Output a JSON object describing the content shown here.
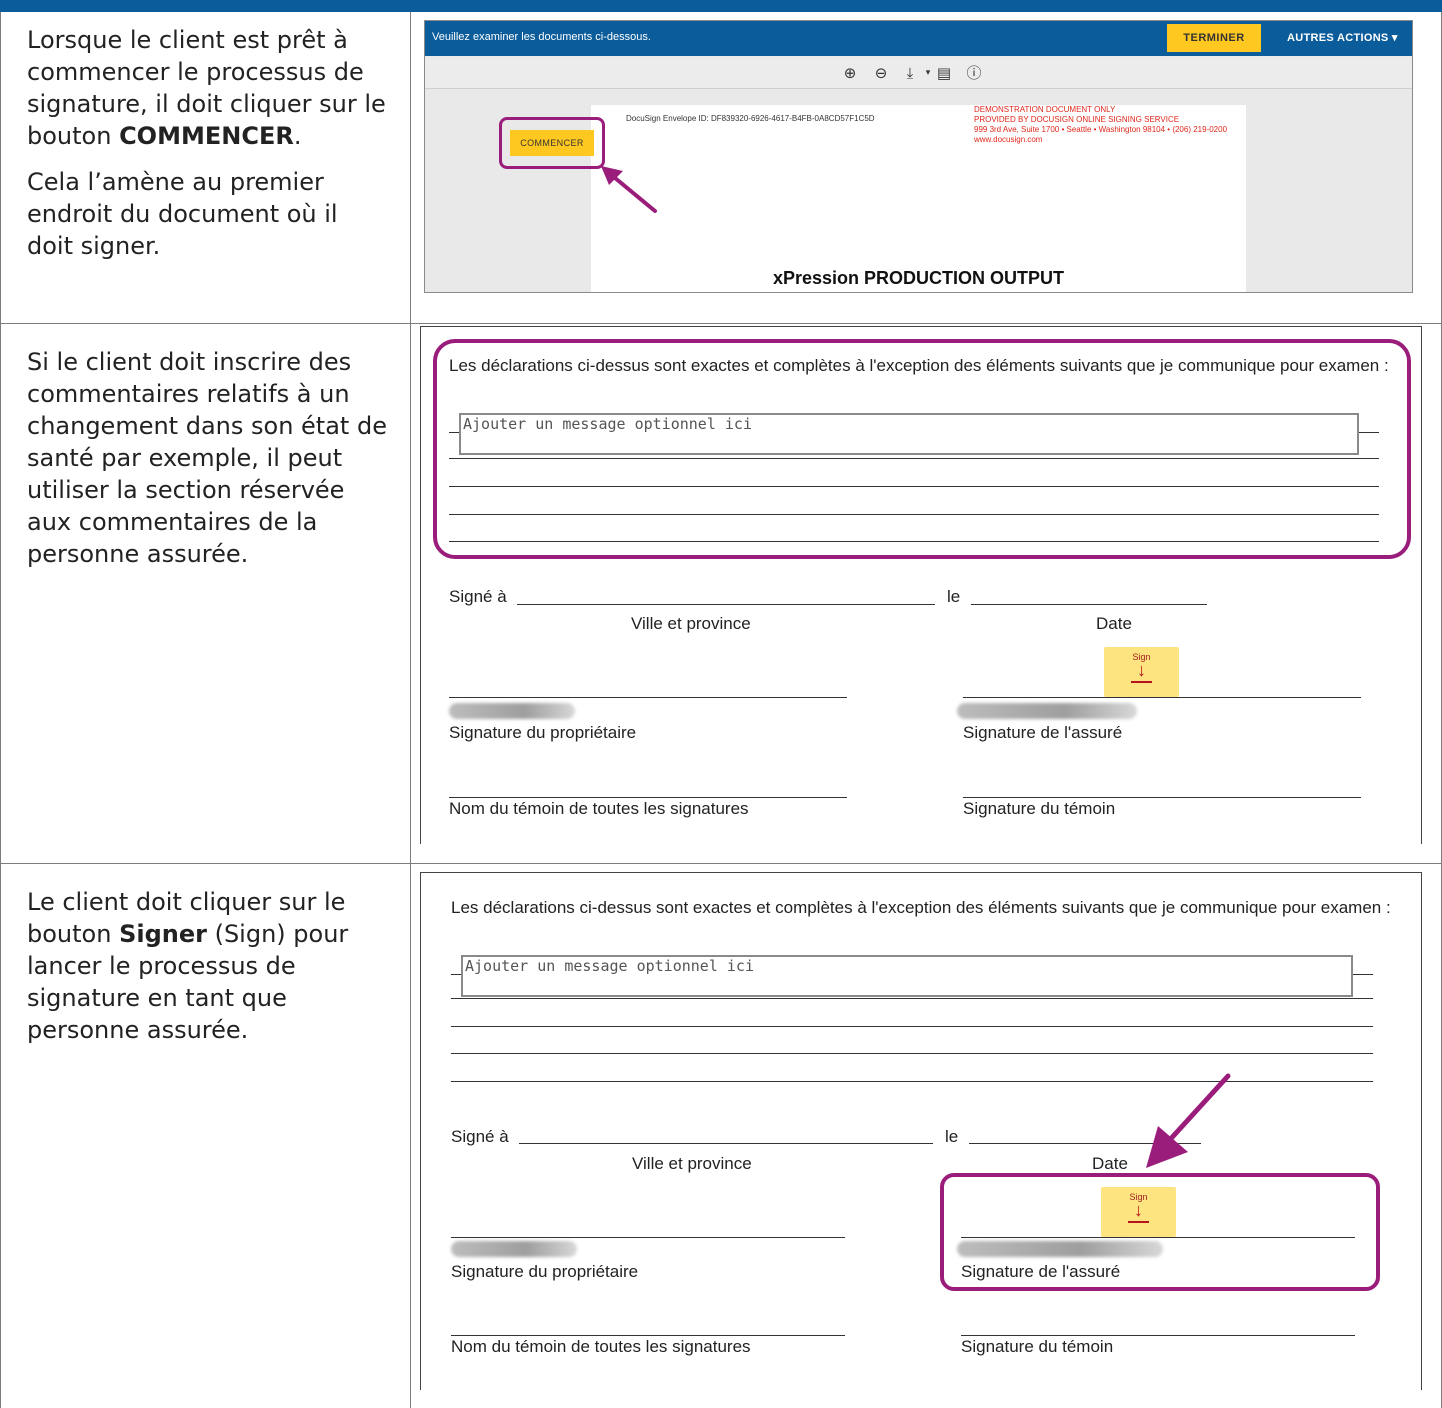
{
  "rows": [
    {
      "instruction": {
        "p1_before": "Lorsque le client est prêt à commencer le processus de signature, il doit cliquer sur le bouton ",
        "p1_bold": "COMMENCER",
        "p1_after": ".",
        "p2": "Cela l’amène au premier endroit du document où il doit signer."
      },
      "docusign": {
        "bar_text": "Veuillez examiner les documents ci-dessous.",
        "finish_button": "TERMINER",
        "other_actions": "AUTRES ACTIONS ▾",
        "toolbar_icons": [
          "zoom-in-icon",
          "zoom-out-icon",
          "download-icon",
          "print-icon",
          "help-icon"
        ],
        "start_button": "COMMENCER",
        "envelope_id": "DocuSign Envelope ID: DF839320-6926-4617-B4FB-0A8CD57F1C5D",
        "demo_lines": [
          "DEMONSTRATION DOCUMENT ONLY",
          "PROVIDED BY DOCUSIGN ONLINE SIGNING SERVICE",
          "999 3rd Ave, Suite 1700 • Seattle • Washington 98104 • (206) 219-0200",
          "www.docusign.com"
        ],
        "heading": "xPression PRODUCTION OUTPUT"
      }
    },
    {
      "instruction": {
        "text": "Si le client doit inscrire des commentaires relatifs à un changement dans son état de santé par exemple, il peut utiliser la section réservée aux commentaires de la personne assurée."
      }
    },
    {
      "instruction": {
        "before": "Le client doit cliquer sur le bouton ",
        "bold": "Signer",
        "after": " (Sign) pour lancer le processus de signature en tant que personne assurée."
      }
    }
  ],
  "form": {
    "declaration": "Les déclarations ci-dessus sont exactes et complètes à l'exception des éléments suivants que je communique pour examen :",
    "message_placeholder": "Ajouter un message optionnel ici",
    "signed_at": "Signé à",
    "le": "le",
    "city_province": "Ville et province",
    "date": "Date",
    "sign_tag": "Sign",
    "owner_signature": "Signature du propriétaire",
    "insured_signature": "Signature de l'assuré",
    "witness_name": "Nom du témoin de toutes les signatures",
    "witness_signature": "Signature du témoin"
  },
  "colors": {
    "header_blue": "#0b5c9b",
    "accent_yellow": "#ffc820",
    "highlight_magenta": "#9a1d7c",
    "demo_red": "#e0281c"
  }
}
